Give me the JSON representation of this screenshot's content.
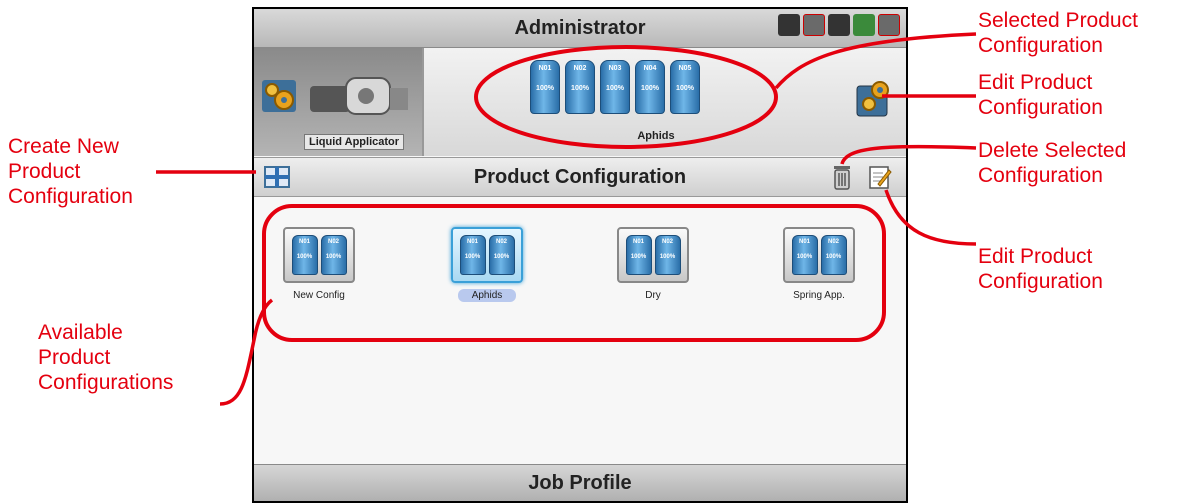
{
  "screen": {
    "title": "Administrator",
    "equipment_label": "Liquid Applicator",
    "selected_config": {
      "name": "Aphids",
      "tanks": [
        {
          "id": "N01",
          "rate": "100%"
        },
        {
          "id": "N02",
          "rate": "100%"
        },
        {
          "id": "N03",
          "rate": "100%"
        },
        {
          "id": "N04",
          "rate": "100%"
        },
        {
          "id": "N05",
          "rate": "100%"
        }
      ]
    },
    "toolbar_title": "Product Configuration",
    "configs": [
      {
        "name": "New Config",
        "selected": false,
        "tanks": [
          {
            "id": "N01",
            "rate": "100%"
          },
          {
            "id": "N02",
            "rate": "100%"
          }
        ]
      },
      {
        "name": "Aphids",
        "selected": true,
        "tanks": [
          {
            "id": "N01",
            "rate": "100%"
          },
          {
            "id": "N02",
            "rate": "100%"
          }
        ]
      },
      {
        "name": "Dry",
        "selected": false,
        "tanks": [
          {
            "id": "N01",
            "rate": "100%"
          },
          {
            "id": "N02",
            "rate": "100%"
          }
        ]
      },
      {
        "name": "Spring App.",
        "selected": false,
        "tanks": [
          {
            "id": "N01",
            "rate": "100%"
          },
          {
            "id": "N02",
            "rate": "100%"
          }
        ]
      }
    ],
    "bottom_title": "Job Profile"
  },
  "callouts": {
    "selected_product_configuration": [
      "Selected Product",
      "Configuration"
    ],
    "edit_product_configuration_top": [
      "Edit Product",
      "Configuration"
    ],
    "delete_selected_configuration": [
      "Delete Selected",
      "Configuration"
    ],
    "edit_product_configuration_bottom": [
      "Edit Product",
      "Configuration"
    ],
    "create_new_product_configuration": [
      "Create New",
      "Product",
      "Configuration"
    ],
    "available_product_configurations": [
      "Available",
      "Product",
      "Configurations"
    ]
  },
  "icons": {
    "status": [
      "field-icon",
      "gps-icon",
      "card-icon",
      "globe-icon",
      "close-icon"
    ],
    "equipment": "gear-icon",
    "sprayer": "sprayer-icon",
    "new": "plus-icon",
    "delete": "trash-icon",
    "edit": "edit-icon"
  },
  "colors": {
    "callout": "#e4000f",
    "selected": "#3aa0d8",
    "tank": "#2a6ea8"
  }
}
